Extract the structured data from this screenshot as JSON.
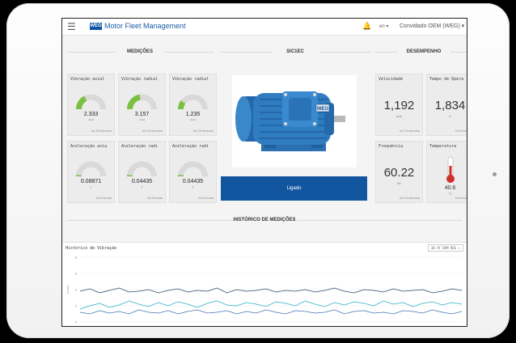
{
  "app": {
    "title": "Motor Fleet Management",
    "logo_text": "WEG",
    "lang": "en",
    "user": "Convidado OEM (WEG)"
  },
  "sections": {
    "measurements": "MEDIÇÕES",
    "motor": "SIC1EC",
    "performance": "DESEMPENHO",
    "history": "HISTÓRICO DE MEDIÇÕES"
  },
  "gauges": [
    {
      "title": "Vibração axial",
      "value": "2.333",
      "unit": "mm/s",
      "ago": "há 15 minutos",
      "level": 0.35
    },
    {
      "title": "Vibração radial",
      "value": "3.157",
      "unit": "mm/s",
      "ago": "há 15 minutos",
      "level": 0.45
    },
    {
      "title": "Vibração radial",
      "value": "1.235",
      "unit": "mm/s",
      "ago": "há 15 minutos",
      "level": 0.2
    },
    {
      "title": "Aceleração axia",
      "value": "0.08871",
      "unit": "g",
      "ago": "há 8 horas",
      "level": 0.02
    },
    {
      "title": "Aceleração radi",
      "value": "0.04435",
      "unit": "g",
      "ago": "há 8 horas",
      "level": 0.01
    },
    {
      "title": "Aceleração radi",
      "value": "0.04435",
      "unit": "g",
      "ago": "há 8 horas",
      "level": 0.01
    }
  ],
  "motor": {
    "status": "Ligado",
    "brand": "WEG"
  },
  "performance": [
    {
      "title": "Velocidade",
      "value": "1,192",
      "unit": "rpm",
      "ago": "há 15 minutos"
    },
    {
      "title": "Tempo de Opera",
      "value": "1,834",
      "unit": "h",
      "ago": "há 8 horas"
    },
    {
      "title": "Frequência",
      "value": "60.22",
      "unit": "Hz",
      "ago": "há 15 minutos"
    },
    {
      "title": "Temperatura",
      "value": "40.6",
      "unit": "°C",
      "ago": "há 8 horas"
    }
  ],
  "history_chart": {
    "title": "Histórico de Vibração",
    "range_select": "30 AT DOM REG",
    "ylabel": "mm/s",
    "colors": {
      "primary": "#1256a0",
      "accent": "#7ac143",
      "alarm": "#d0302b"
    }
  },
  "chart_data": {
    "type": "line",
    "ylim": [
      0,
      8
    ],
    "yticks": [
      "8",
      "6",
      "4",
      "2",
      "0"
    ],
    "series": [
      {
        "color": "#2e4a6b",
        "values": [
          3.8,
          4.1,
          3.6,
          3.9,
          4.2,
          3.7,
          3.8,
          4.0,
          3.6,
          3.9,
          4.1,
          3.7,
          3.9,
          3.8,
          4.2,
          3.6,
          4.0,
          3.8,
          3.9,
          4.1,
          3.7,
          3.9,
          3.8,
          4.0,
          3.7,
          3.9,
          4.2,
          3.8,
          3.6,
          4.0,
          3.9,
          3.7,
          4.1,
          3.8,
          3.9,
          4.0,
          3.6,
          3.8,
          4.1,
          3.9
        ]
      },
      {
        "color": "#2ab0c8",
        "values": [
          1.6,
          2.0,
          2.3,
          1.8,
          2.1,
          2.6,
          2.2,
          1.9,
          2.4,
          2.0,
          2.5,
          2.2,
          1.8,
          2.3,
          2.6,
          2.1,
          2.0,
          2.4,
          2.2,
          1.9,
          2.5,
          2.3,
          2.0,
          2.6,
          2.2,
          1.9,
          2.4,
          2.1,
          2.5,
          2.3,
          2.0,
          2.6,
          2.2,
          2.4,
          1.9,
          2.3,
          2.5,
          2.1,
          2.4,
          2.2
        ]
      },
      {
        "color": "#4575b4",
        "values": [
          1.2,
          1.0,
          1.4,
          1.1,
          1.3,
          1.0,
          1.5,
          1.2,
          1.1,
          1.4,
          1.0,
          1.3,
          1.5,
          1.1,
          1.2,
          1.4,
          1.0,
          1.3,
          1.1,
          1.5,
          1.2,
          1.0,
          1.4,
          1.3,
          1.1,
          1.2,
          1.5,
          1.0,
          1.3,
          1.4,
          1.1,
          1.2,
          1.0,
          1.4,
          1.3,
          1.1,
          1.5,
          1.2,
          1.0,
          1.3
        ]
      }
    ]
  }
}
